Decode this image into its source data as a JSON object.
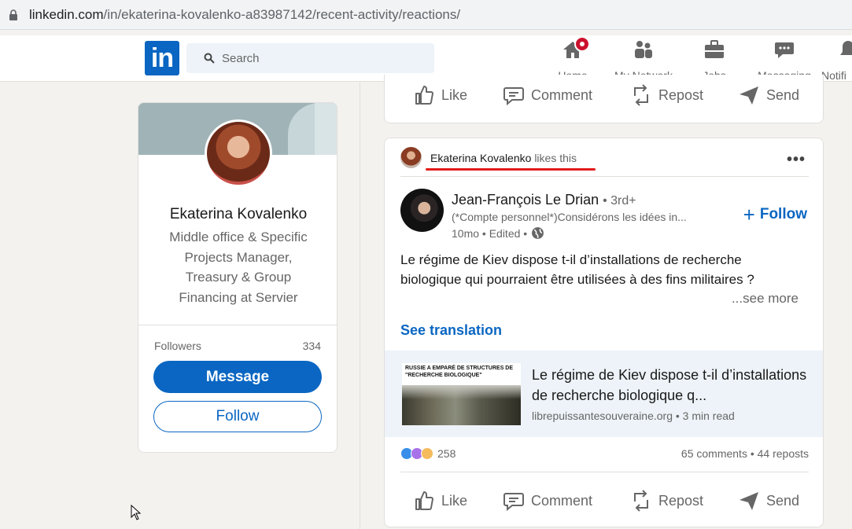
{
  "browser": {
    "url_host": "linkedin.com",
    "url_path": "/in/ekaterina-kovalenko-a83987142/recent-activity/reactions/"
  },
  "nav": {
    "logo_text": "in",
    "search_placeholder": "Search",
    "items": [
      {
        "label": "Home",
        "icon": "home-icon",
        "has_badge": true
      },
      {
        "label": "My Network",
        "icon": "network-icon"
      },
      {
        "label": "Jobs",
        "icon": "briefcase-icon"
      },
      {
        "label": "Messaging",
        "icon": "messaging-icon"
      },
      {
        "label": "Notifi",
        "icon": "bell-icon"
      }
    ]
  },
  "profile": {
    "name": "Ekaterina Kovalenko",
    "headline": "Middle office & Specific Projects Manager, Treasury & Group Financing at Servier",
    "followers_label": "Followers",
    "followers_count": "334",
    "message_button": "Message",
    "follow_button": "Follow"
  },
  "actions": {
    "like": "Like",
    "comment": "Comment",
    "repost": "Repost",
    "send": "Send"
  },
  "post": {
    "liker_name": "Ekaterina Kovalenko",
    "liker_suffix": "likes this",
    "author_name": "Jean-François Le Drian",
    "author_degree": "• 3rd+",
    "author_subtitle": "(*Compte personnel*)Considérons les idées in...",
    "author_time": "10mo • Edited •",
    "follow_label": "Follow",
    "text": "Le régime de Kiev dispose t-il d’installations de recherche biologique qui pourraient être utilisées à des fins militaires ?",
    "see_more": "...see more",
    "see_translation": "See translation",
    "link_thumb_headline": "RUSSIE A EMPARÉ DE STRUCTURES DE \"RECHERCHE BIOLOGIQUE\"",
    "link_title": "Le régime de Kiev dispose t-il d’installations de recherche biologique q...",
    "link_source": "librepuissantesouveraine.org • 3 min read",
    "reaction_count": "258",
    "comments_reposts": "65 comments • 44 reposts"
  },
  "colors": {
    "brand": "#0a66c2",
    "badge": "#cb112d",
    "annotation_underline": "#e21b1b"
  }
}
